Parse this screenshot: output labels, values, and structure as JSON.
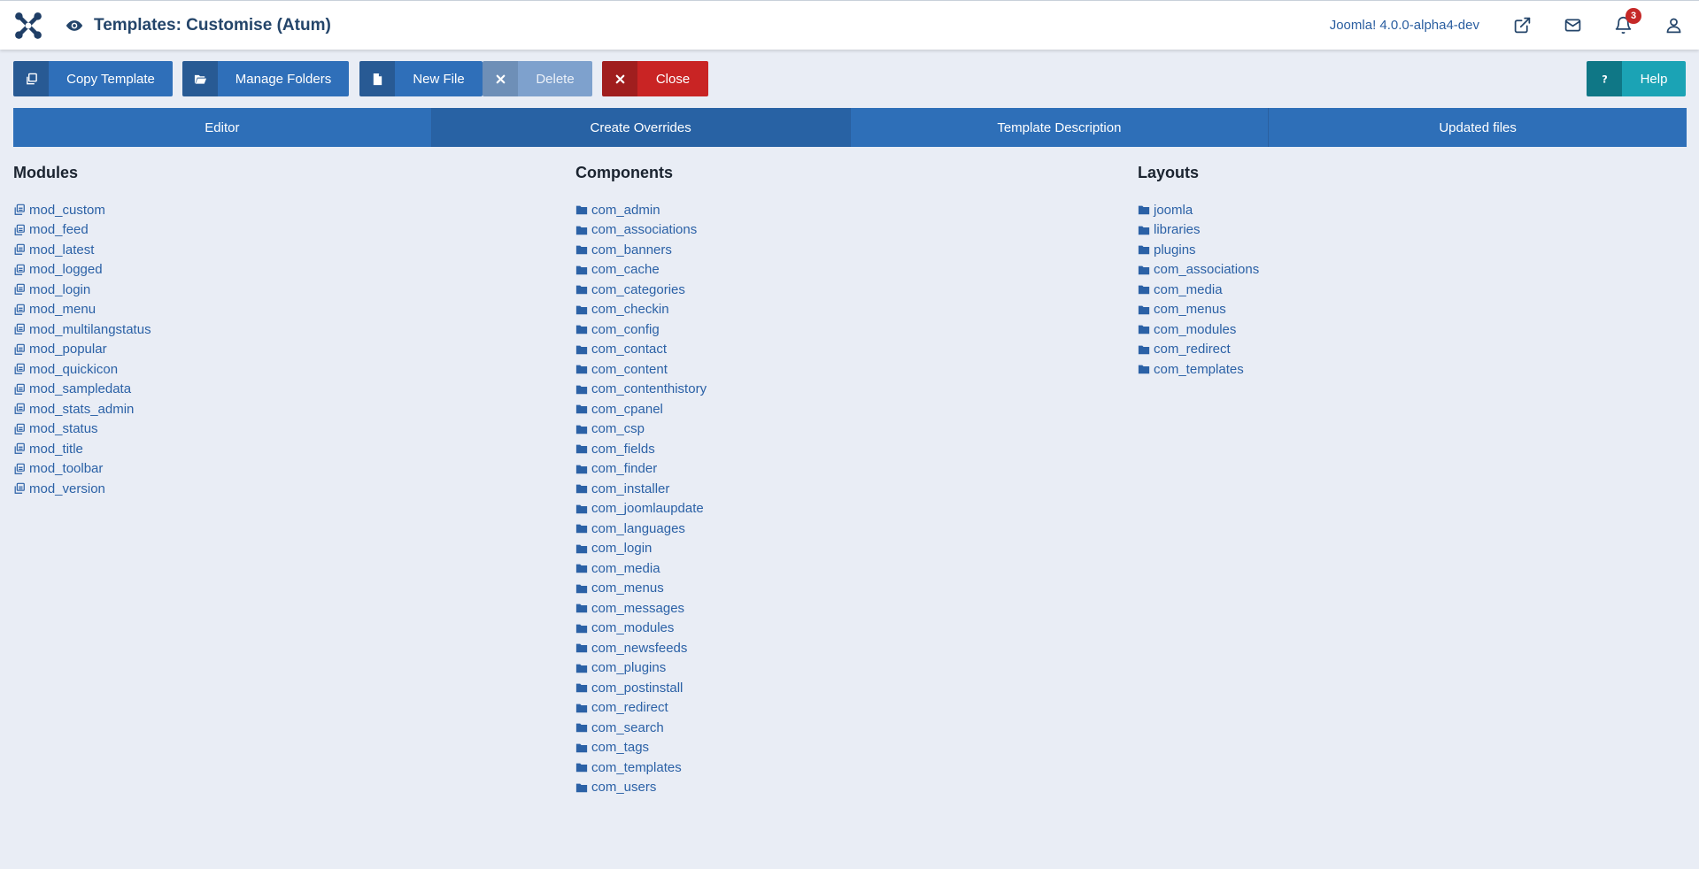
{
  "header": {
    "title": "Templates: Customise (Atum)",
    "version": "Joomla! 4.0.0-alpha4-dev",
    "notification_count": "3"
  },
  "toolbar": {
    "copy_template": "Copy Template",
    "manage_folders": "Manage Folders",
    "new_file": "New File",
    "delete": "Delete",
    "close": "Close",
    "help": "Help"
  },
  "tabs": [
    {
      "label": "Editor"
    },
    {
      "label": "Create Overrides"
    },
    {
      "label": "Template Description"
    },
    {
      "label": "Updated files"
    }
  ],
  "modules": {
    "heading": "Modules",
    "items": [
      "mod_custom",
      "mod_feed",
      "mod_latest",
      "mod_logged",
      "mod_login",
      "mod_menu",
      "mod_multilangstatus",
      "mod_popular",
      "mod_quickicon",
      "mod_sampledata",
      "mod_stats_admin",
      "mod_status",
      "mod_title",
      "mod_toolbar",
      "mod_version"
    ]
  },
  "components": {
    "heading": "Components",
    "items": [
      "com_admin",
      "com_associations",
      "com_banners",
      "com_cache",
      "com_categories",
      "com_checkin",
      "com_config",
      "com_contact",
      "com_content",
      "com_contenthistory",
      "com_cpanel",
      "com_csp",
      "com_fields",
      "com_finder",
      "com_installer",
      "com_joomlaupdate",
      "com_languages",
      "com_login",
      "com_media",
      "com_menus",
      "com_messages",
      "com_modules",
      "com_newsfeeds",
      "com_plugins",
      "com_postinstall",
      "com_redirect",
      "com_search",
      "com_tags",
      "com_templates",
      "com_users"
    ]
  },
  "layouts": {
    "heading": "Layouts",
    "items": [
      "joomla",
      "libraries",
      "plugins",
      "com_associations",
      "com_media",
      "com_menus",
      "com_modules",
      "com_redirect",
      "com_templates"
    ]
  },
  "colors": {
    "primary": "#2f6fb9",
    "danger": "#c92424",
    "info": "#1ba3b5",
    "link": "#2b61a6",
    "background": "#e9edf5"
  },
  "icons": {
    "module_item": "copy-icon",
    "folder_item": "folder-icon"
  }
}
